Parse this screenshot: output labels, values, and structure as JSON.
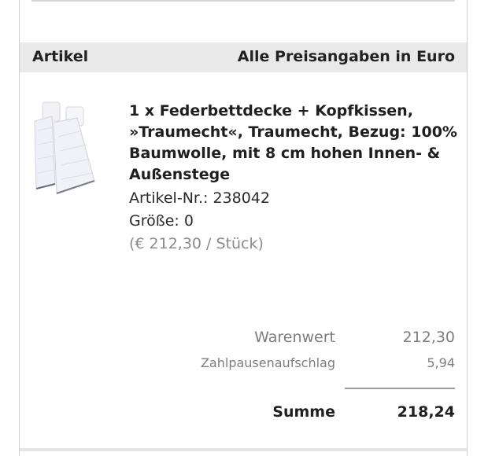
{
  "header": {
    "left_label": "Artikel",
    "right_label": "Alle Preisangaben in Euro"
  },
  "product": {
    "image_icon": "bedding-image",
    "title": "1 x Federbettdecke + Kopfkissen, »Traumecht«, Traumecht, Bezug: 100% Baumwolle, mit 8 cm hohen Innen- & Außenstege",
    "article_number": "Artikel-Nr.: 238042",
    "size": "Größe: 0",
    "unit_price": "(€ 212,30 / Stück)"
  },
  "totals": {
    "goods_value_label": "Warenwert",
    "goods_value": "212,30",
    "surcharge_label": "Zahlpausenaufschlag",
    "surcharge": "5,94",
    "sum_label": "Summe",
    "sum": "218,24"
  }
}
